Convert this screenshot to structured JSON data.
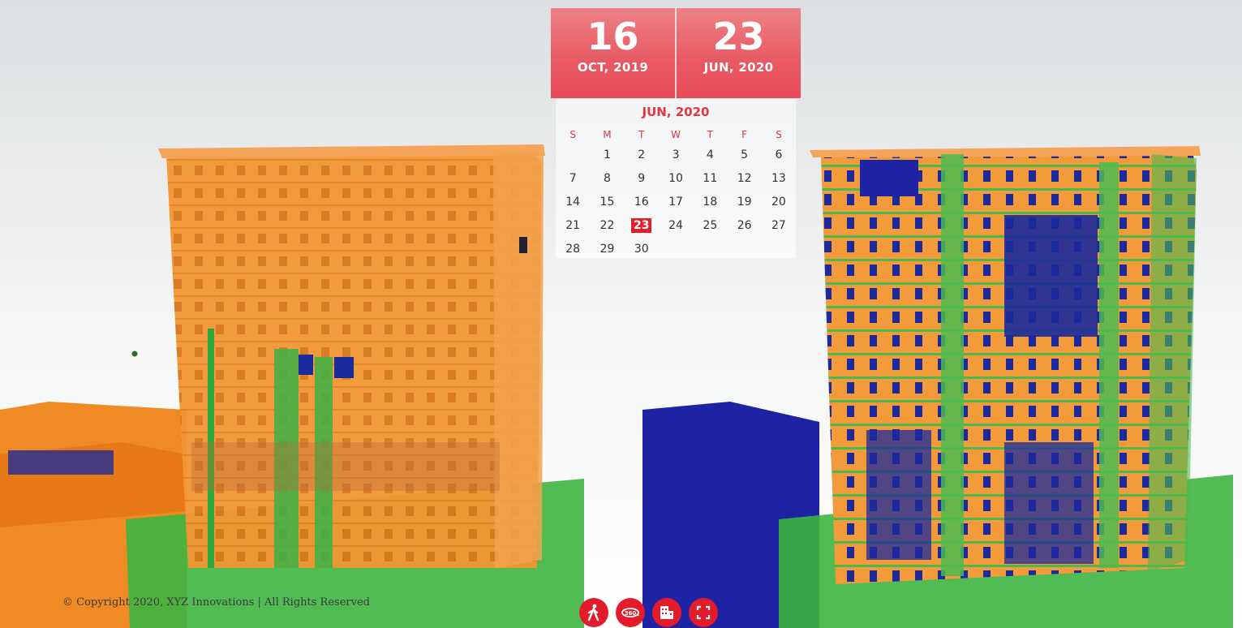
{
  "comparison": {
    "start": {
      "day": "16",
      "month_year": "OCT, 2019"
    },
    "end": {
      "day": "23",
      "month_year": "JUN, 2020"
    }
  },
  "calendar": {
    "title": "JUN, 2020",
    "weekdays": [
      "S",
      "M",
      "T",
      "W",
      "T",
      "F",
      "S"
    ],
    "days": [
      "",
      "1",
      "2",
      "3",
      "4",
      "5",
      "6",
      "7",
      "8",
      "9",
      "10",
      "11",
      "12",
      "13",
      "14",
      "15",
      "16",
      "17",
      "18",
      "19",
      "20",
      "21",
      "22",
      "23",
      "24",
      "25",
      "26",
      "27",
      "28",
      "29",
      "30"
    ],
    "selected_day": "23"
  },
  "footer": {
    "copyright": "© Copyright 2020, XYZ Innovations | All Rights Reserved"
  },
  "toolbar": {
    "buttons": [
      {
        "icon": "walk-icon"
      },
      {
        "icon": "360-view-icon"
      },
      {
        "icon": "building-icon"
      },
      {
        "icon": "fullscreen-icon"
      }
    ]
  },
  "colors": {
    "accent": "#e31b2a",
    "orange": "#f08a1c",
    "green": "#3db540",
    "blue": "#1b2a9c"
  }
}
